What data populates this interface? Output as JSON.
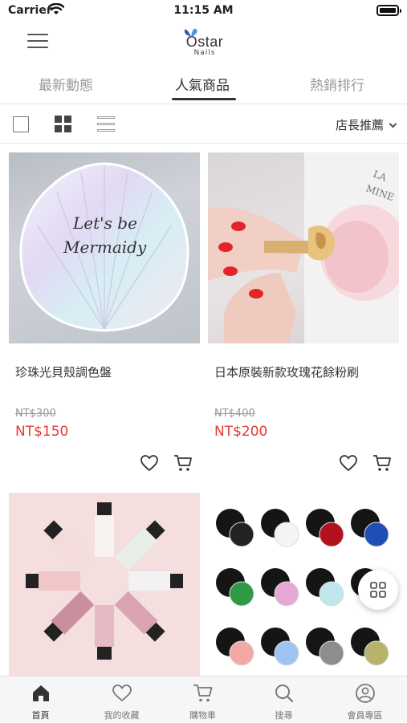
{
  "status_bar": {
    "carrier": "Carrier",
    "time": "11:15 AM"
  },
  "header": {
    "logo_main": "Ostar",
    "logo_sub": "Nails"
  },
  "tabs": [
    {
      "label": "最新動態",
      "active": false
    },
    {
      "label": "人氣商品",
      "active": true
    },
    {
      "label": "熱銷排行",
      "active": false
    }
  ],
  "controls": {
    "sort_label": "店長推薦"
  },
  "products": [
    {
      "name": "珍珠光貝殼調色盤",
      "original_price": "NT$300",
      "sale_price": "NT$150",
      "image_text_1": "Let's be",
      "image_text_2": "Mermaidy"
    },
    {
      "name": "日本原裝新款玫瑰花餘粉刷",
      "original_price": "NT$400",
      "sale_price": "NT$200",
      "image_text_1": "LA",
      "image_text_2": "MINE"
    },
    {
      "name": "",
      "original_price": "",
      "sale_price": ""
    },
    {
      "name": "",
      "original_price": "",
      "sale_price": ""
    }
  ],
  "bottom_nav": [
    {
      "label": "首頁",
      "icon": "home-icon",
      "active": true
    },
    {
      "label": "我的收藏",
      "icon": "heart-icon",
      "active": false
    },
    {
      "label": "購物車",
      "icon": "cart-icon",
      "active": false
    },
    {
      "label": "搜尋",
      "icon": "search-icon",
      "active": false
    },
    {
      "label": "會員專區",
      "icon": "user-icon",
      "active": false
    }
  ],
  "colors": {
    "accent": "#e53935",
    "text": "#333333",
    "muted": "#9a9a9a"
  }
}
